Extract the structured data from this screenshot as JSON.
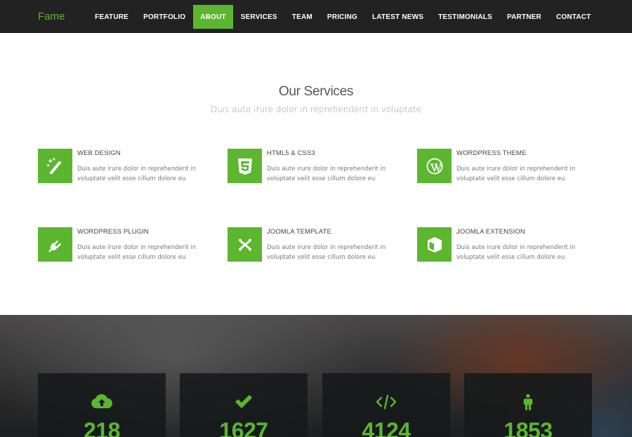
{
  "brand": {
    "name": "Fame",
    "color": "#5cb630"
  },
  "nav": {
    "items": [
      {
        "label": "FEATURE",
        "active": false
      },
      {
        "label": "PORTFOLIO",
        "active": false
      },
      {
        "label": "ABOUT",
        "active": true
      },
      {
        "label": "SERVICES",
        "active": false
      },
      {
        "label": "TEAM",
        "active": false
      },
      {
        "label": "PRICING",
        "active": false
      },
      {
        "label": "LATEST NEWS",
        "active": false
      },
      {
        "label": "TESTIMONIALS",
        "active": false
      },
      {
        "label": "PARTNER",
        "active": false
      },
      {
        "label": "CONTACT",
        "active": false
      }
    ]
  },
  "services": {
    "title": "Our Services",
    "subtitle": "Duis aute irure dolor in reprehenderit in voluptate",
    "items": [
      {
        "title": "WEB DESIGN",
        "text": "Duis aute irure dolor in reprehenderit in voluptate velit esse cillum dolore eu",
        "icon": "magic-wand-icon"
      },
      {
        "title": "HTML5 & CSS3",
        "text": "Duis aute irure dolor in reprehenderit in voluptate velit esse cillum dolore eu",
        "icon": "css3-icon"
      },
      {
        "title": "WORDPRESS THEME",
        "text": "Duis aute irure dolor in reprehenderit in voluptate velit esse cillum dolore eu",
        "icon": "wordpress-icon"
      },
      {
        "title": "WORDPRESS PLUGIN",
        "text": "Duis aute irure dolor in reprehenderit in voluptate velit esse cillum dolore eu",
        "icon": "plug-icon"
      },
      {
        "title": "JOOMLA TEMPLATE",
        "text": "Duis aute irure dolor in reprehenderit in voluptate velit esse cillum dolore eu",
        "icon": "joomla-icon"
      },
      {
        "title": "JOOMLA EXTENSION",
        "text": "Duis aute irure dolor in reprehenderit in voluptate velit esse cillum dolore eu",
        "icon": "cube-icon"
      }
    ]
  },
  "stats": {
    "items": [
      {
        "value": "218",
        "icon": "cloud-upload-icon"
      },
      {
        "value": "1627",
        "icon": "check-icon"
      },
      {
        "value": "4124",
        "icon": "code-icon"
      },
      {
        "value": "1853",
        "icon": "person-icon"
      }
    ]
  },
  "colors": {
    "accent": "#5cb630",
    "navbar": "#222222",
    "stat_box": "#16191a"
  }
}
